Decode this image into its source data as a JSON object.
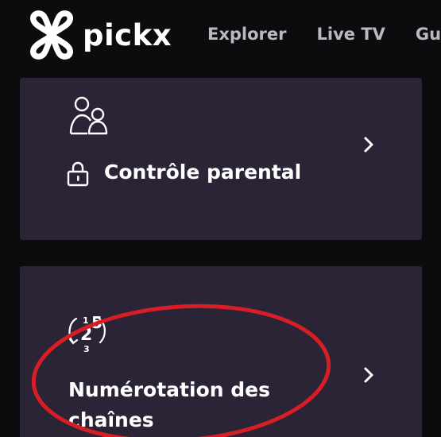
{
  "header": {
    "logo_text": "pickx",
    "nav": [
      {
        "label": "Explorer"
      },
      {
        "label": "Live TV"
      },
      {
        "label": "Gui"
      }
    ]
  },
  "cards": {
    "parental": {
      "title": "Contrôle parental",
      "icon": "users-icon",
      "title_icon": "lock-icon"
    },
    "numbering": {
      "title": "Numérotation des chaînes",
      "icon": "channel-numbering-icon",
      "icon_digits": [
        "1",
        "2",
        "3",
        "5"
      ]
    }
  },
  "colors": {
    "background": "#0c0b0d",
    "card": "#2a2436",
    "text": "#ffffff",
    "nav_text": "#b9b9bf",
    "annotation": "#d81e25"
  }
}
